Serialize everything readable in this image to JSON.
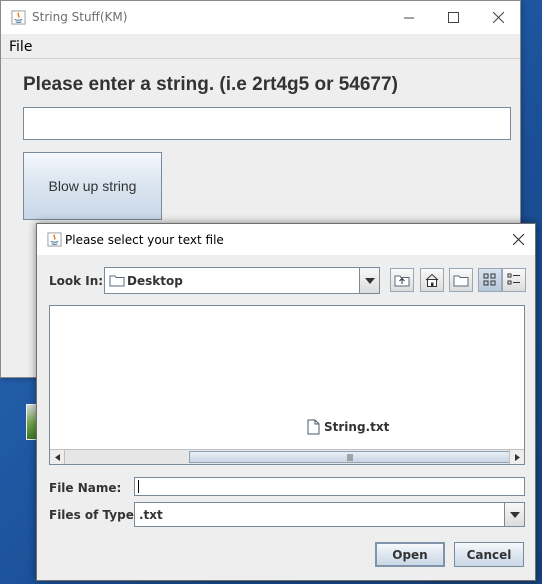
{
  "main_window": {
    "title": "String Stuff(KM)",
    "menu": {
      "file_label": "File"
    },
    "prompt": "Please enter a string. (i.e 2rt4g5 or 54677)",
    "input_value": "",
    "blow_button_label": "Blow up string"
  },
  "dialog": {
    "title": "Please select your text file",
    "look_in_label": "Look In:",
    "look_in_value": "Desktop",
    "files": [
      {
        "name": "String.txt",
        "icon": "text-file-icon"
      }
    ],
    "file_name_label": "File Name:",
    "file_name_value": "",
    "files_of_type_label": "Files of Type:",
    "files_of_type_value": ".txt",
    "open_label": "Open",
    "cancel_label": "Cancel",
    "toolbar_icons": [
      "up-one-level-icon",
      "home-icon",
      "new-folder-icon",
      "list-view-icon",
      "details-view-icon"
    ]
  },
  "colors": {
    "window_bg": "#eeeeee",
    "button_gradient_top": "#f5f8fc",
    "button_gradient_bottom": "#c8d7e8",
    "border": "#7a8a99"
  }
}
